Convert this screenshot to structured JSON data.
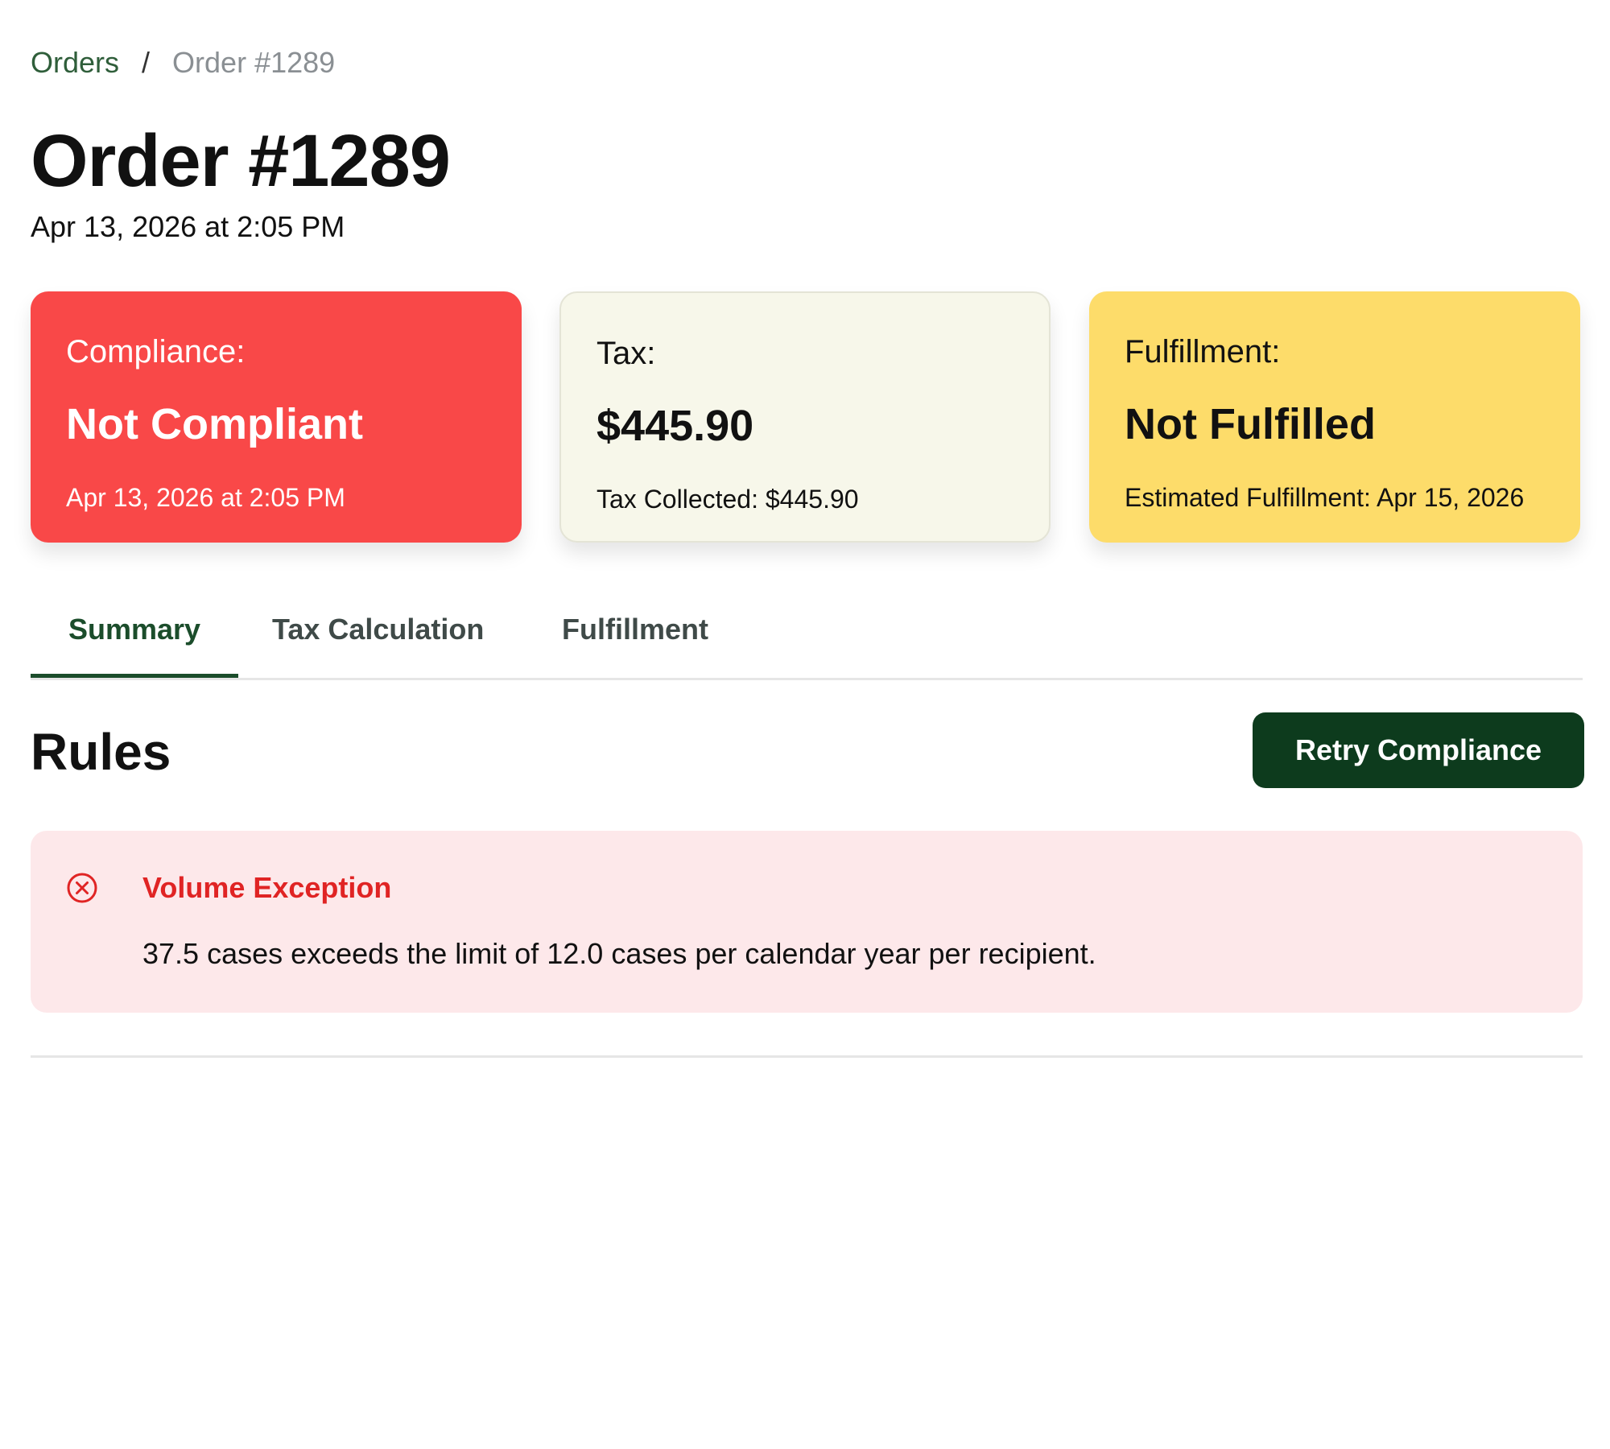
{
  "breadcrumb": {
    "parent": "Orders",
    "separator": "/",
    "current": "Order #1289"
  },
  "header": {
    "title": "Order #1289",
    "timestamp": "Apr 13, 2026 at 2:05 PM"
  },
  "cards": {
    "compliance": {
      "label": "Compliance:",
      "value": "Not Compliant",
      "detail": "Apr 13, 2026 at 2:05 PM",
      "color": "#f94848"
    },
    "tax": {
      "label": "Tax:",
      "value": "$445.90",
      "detail": "Tax Collected: $445.90",
      "color": "#f7f7ea"
    },
    "fulfillment": {
      "label": "Fulfillment:",
      "value": "Not Fulfilled",
      "detail": "Estimated Fulfillment: Apr 15, 2026",
      "color": "#fddc6a"
    }
  },
  "tabs": [
    {
      "label": "Summary",
      "active": true
    },
    {
      "label": "Tax Calculation",
      "active": false
    },
    {
      "label": "Fulfillment",
      "active": false
    }
  ],
  "rules": {
    "title": "Rules",
    "retry_label": "Retry Compliance",
    "alerts": [
      {
        "icon": "error-circle-x-icon",
        "title": "Volume Exception",
        "message": "37.5 cases exceeds the limit of 12.0 cases per calendar year per recipient."
      }
    ]
  },
  "colors": {
    "brand_green": "#0d3b1d",
    "active_tab": "#1b4d2b",
    "error_red": "#e02424",
    "alert_background": "#fde8ea"
  }
}
